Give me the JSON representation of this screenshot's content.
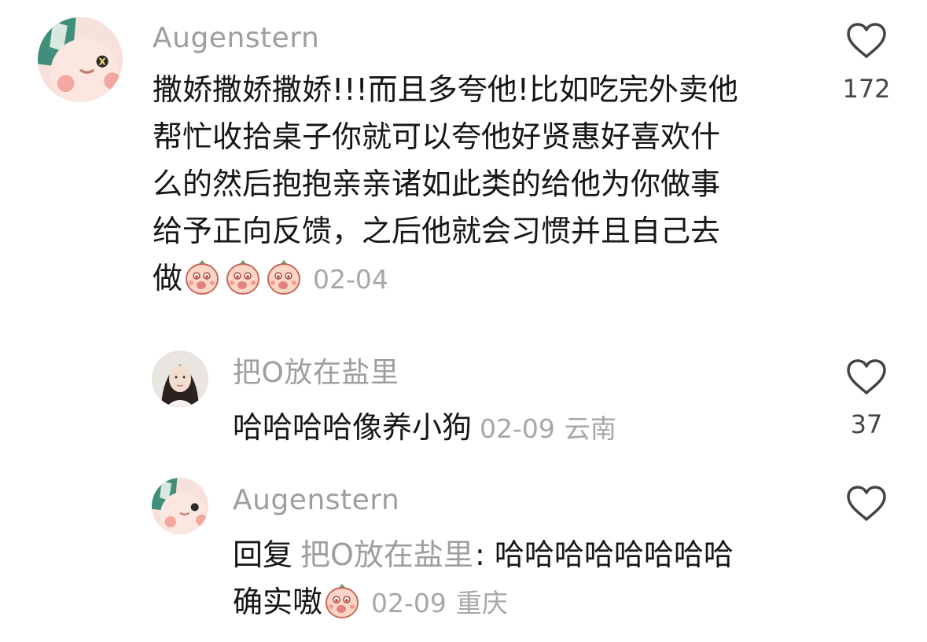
{
  "comments": [
    {
      "username": "Augenstern",
      "lines": [
        "撒娇撒娇撒娇!!!而且多夸他!比如吃完外卖他",
        "帮忙收拾桌子你就可以夸他好贤惠好喜欢什",
        "么的然后抱抱亲亲诸如此类的给他为你做事",
        "给予正向反馈，之后他就会习惯并且自己去"
      ],
      "last_line_text": "做",
      "emoji_icon": "peach-face-emoji",
      "date": "02-04",
      "like_count": "172"
    }
  ],
  "replies": [
    {
      "username": "把O放在盐里",
      "text": "哈哈哈哈像养小狗",
      "date": "02-09",
      "location": "云南",
      "like_count": "37"
    },
    {
      "username": "Augenstern",
      "reply_prefix": "回复",
      "reply_target": "把O放在盐里",
      "reply_text": ": 哈哈哈哈哈哈哈哈",
      "line2_text": "确实嗷",
      "emoji_icon": "peach-face-emoji",
      "date": "02-09",
      "location": "重庆"
    }
  ],
  "icons": {
    "like": "heart-outline-icon"
  },
  "colors": {
    "username": "#9e9e9e",
    "text": "#161616",
    "meta": "#a7a7a7",
    "icon": "#444444"
  }
}
